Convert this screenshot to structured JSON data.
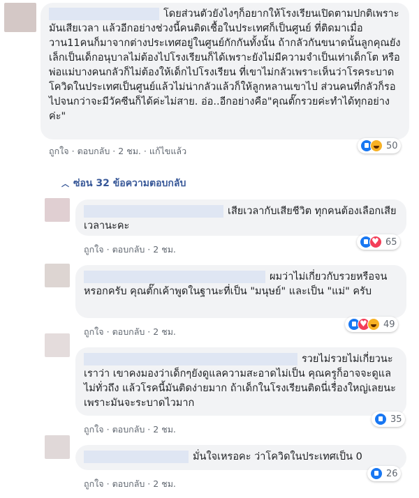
{
  "top_comment": {
    "text": "โดยส่วนตัวยังไงๆก็อยากให้โรงเรียนเปิดตามปกติเพราะมันเสียเวลา แล้วอีกอย่างช่วงนี้คนติดเชื้อในประเทศก็เป็นศูนย์ ที่ติดมาเมื่อวาน11คนก็มาจากต่างประเทศอยู่ในศูนย์กักกันทั้งนั้น ถ้ากลัวกันขนาดนั้นลูกคุณยังเล็กเป็นเด็กอนุบาลไม่ต้องไปโรงเรียนก็ได้เพราะยังไม่มีความจำเป็นเท่าเด็กโต หรือพ่อแม่บางคนกลัวก็ไม่ต้องให้เด็กไปโรงเรียน ที่เขาไม่กลัวเพราะเห็นว่าโรคระบาดโควิดในประเทศเป็นศูนย์แล้วไม่น่ากลัวแล้วก็ให้ลูกหลานเขาไป ส่วนคนที่กลัวก็รอไปจนกว่าจะมีวัคซีนก็ได้ค่ะไม่สาย. อ่อ..อีกอย่างคือ\"คุณตั๊กรวยค่ะทำได้ทุกอย่างค่ะ\"",
    "like": "ถูกใจ",
    "reply": "ตอบกลับ",
    "time": "2 ชม.",
    "edited": "แก้ไขแล้ว",
    "reaction_count": "50"
  },
  "hide_replies": "ซ่อน 32 ข้อความตอบกลับ",
  "replies": [
    {
      "text": "เสียเวลากับเสียชีวิต ทุกคนต้องเลือกเสียเวลานะคะ",
      "like": "ถูกใจ",
      "reply": "ตอบกลับ",
      "time": "2 ชม.",
      "reaction_count": "65"
    },
    {
      "text": "ผมว่าไม่เกี่ยวกับรวยหรือจนหรอกครับ คุณตั๊กเค้าพูดในฐานะที่เป็น \"มนุษย์\" และเป็น \"แม่\" ครับ",
      "like": "ถูกใจ",
      "reply": "ตอบกลับ",
      "time": "2 ชม.",
      "reaction_count": "49"
    },
    {
      "text": "รวยไม่รวยไม่เกี่ยวนะเราว่า เขาคงมองว่าเด็กๆยังดูแลความสะอาดไม่เป็น คุณครูก็อาจจะดูแลไม่ทั่วถึง แล้วโรคนี้มันติดง่ายมาก ถ้าเด็กในโรงเรียนติดนี่เรื่องใหญ่เลยนะ เพราะมันจะระบาดไวมาก",
      "like": "ถูกใจ",
      "reply": "ตอบกลับ",
      "time": "2 ชม.",
      "reaction_count": "35"
    },
    {
      "text": "มั่นใจเหรอคะ ว่าโควิดในประเทศเป็น 0",
      "like": "ถูกใจ",
      "reply": "ตอบกลับ",
      "time": "2 ชม.",
      "reaction_count": "26"
    }
  ]
}
